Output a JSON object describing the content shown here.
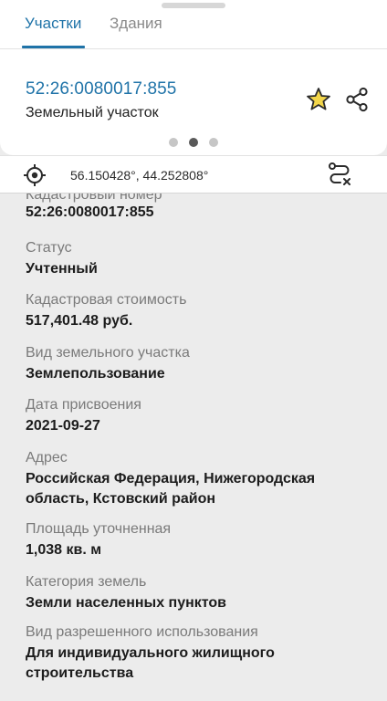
{
  "tabs": [
    {
      "label": "Участки",
      "active": true
    },
    {
      "label": "Здания",
      "active": false
    }
  ],
  "parcel": {
    "number": "52:26:0080017:855",
    "type": "Земельный участок"
  },
  "pager": {
    "count": 3,
    "active_index": 1
  },
  "coordinates": {
    "text": "56.150428°, 44.252808°"
  },
  "details": {
    "cadastral_number_label": "Кадастровый номер",
    "cadastral_number_value": "52:26:0080017:855",
    "items": [
      {
        "label": "Статус",
        "value": "Учтенный"
      },
      {
        "label": "Кадастровая стоимость",
        "value": "517,401.48 руб."
      },
      {
        "label": "Вид земельного участка",
        "value": "Землепользование"
      },
      {
        "label": "Дата присвоения",
        "value": "2021-09-27"
      },
      {
        "label": "Адрес",
        "value": "Российская Федерация, Нижегородская область, Кстовский район"
      },
      {
        "label": "Площадь уточненная",
        "value": "1,038 кв. м"
      },
      {
        "label": "Категория земель",
        "value": "Земли населенных пунктов"
      },
      {
        "label": "Вид разрешенного использования",
        "value": "Для индивидуального жилищного строительства"
      }
    ]
  },
  "colors": {
    "accent": "#1f73a8",
    "star": "#e8c21a",
    "background": "#ececec"
  },
  "icons": {
    "favorite": "star-icon",
    "share": "share-icon",
    "locate": "crosshair-icon",
    "route": "route-icon"
  }
}
